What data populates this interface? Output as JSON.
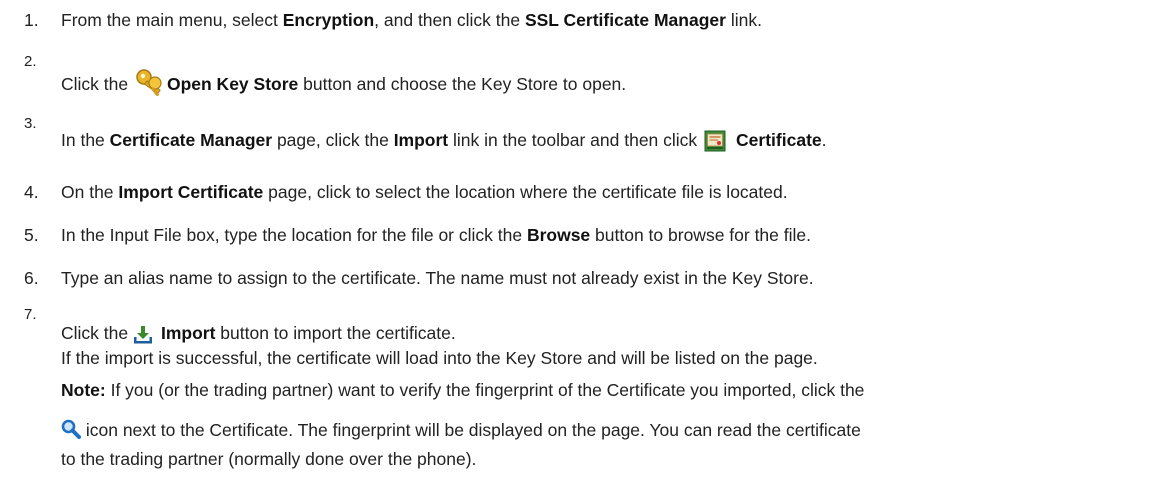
{
  "steps": [
    {
      "num": "1.",
      "parts": [
        "From the main menu, select ",
        "Encryption",
        ", and then click the ",
        "SSL Certificate Manager",
        " link."
      ]
    },
    {
      "num": "2.",
      "parts": [
        "Click the ",
        "Open Key Store",
        " button and choose the Key Store to open."
      ],
      "icon": "key-icon"
    },
    {
      "num": "3.",
      "parts": [
        "In the ",
        "Certificate Manager",
        " page, click the  ",
        "Import",
        " link in the toolbar and then click ",
        "Certificate",
        "."
      ],
      "icon": "certificate-icon"
    },
    {
      "num": "4.",
      "parts": [
        "On the ",
        "Import Certificate",
        " page, click to select the location where the certificate file is located."
      ]
    },
    {
      "num": "5.",
      "parts": [
        "In the Input File box, type the location for the file or click the ",
        "Browse",
        " button to browse for the file."
      ]
    },
    {
      "num": "6.",
      "parts": [
        "Type an alias name to assign to the certificate. The name must not already exist in the Key Store."
      ]
    },
    {
      "num": "7.",
      "parts": [
        "Click the ",
        "Import",
        " button to import the certificate."
      ],
      "icon": "download-arrow-icon",
      "followup": "If the import is successful, the certificate will load into the Key Store and will be listed on the page."
    }
  ],
  "note": {
    "label": "Note:",
    "line1": " If you (or the trading partner) want to verify the fingerprint of the Certificate you imported, click the",
    "line2": " icon next to the Certificate. The fingerprint will be displayed on the page. You can read the certificate",
    "line3": "to the trading partner (normally done over the phone).",
    "icon": "magnifier-icon"
  },
  "colors": {
    "text": "#222222",
    "icon_blue": "#1f6fc4",
    "icon_green": "#3a8a2a"
  }
}
